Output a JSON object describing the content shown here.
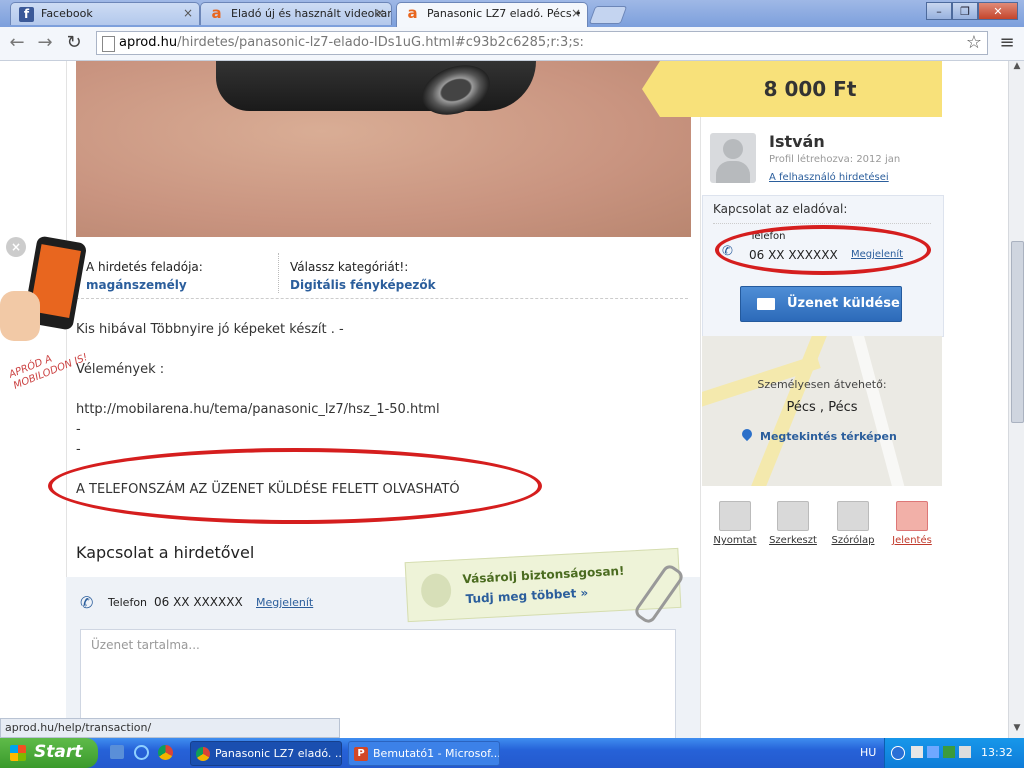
{
  "browser": {
    "tabs": [
      {
        "title": "Facebook",
        "close": "×"
      },
      {
        "title": "Eladó új és használt videokar",
        "close": "×"
      },
      {
        "title": "Panasonic LZ7 eladó. Pécs •",
        "close": "×"
      }
    ],
    "url_domain": "aprod.hu",
    "url_path": "/hirdetes/panasonic-lz7-elado-IDs1uG.html#c93b2c6285;r:3;s:",
    "status_url": "aprod.hu/help/transaction/",
    "window_buttons": [
      "–",
      "❐",
      "✕"
    ],
    "nav": {
      "back": "←",
      "forward": "→",
      "reload": "↻",
      "star": "☆",
      "menu": "≡"
    }
  },
  "listing": {
    "poster_label": "A hirdetés feladója:",
    "poster_value": "magánszemély",
    "category_label": "Válassz kategóriát!:",
    "category_value": "Digitális fényképezők",
    "description_lines": [
      "Kis hibával Többnyire jó képeket készít . -",
      "Vélemények :",
      "http://mobilarena.hu/tema/panasonic_lz7/hsz_1-50.html",
      "-",
      "-",
      "A TELEFONSZÁM AZ ÜZENET KÜLDÉSE FELETT OLVASHATÓ"
    ],
    "contact_heading": "Kapcsolat a hirdetővel",
    "contact_phone_label": "Telefon",
    "contact_phone_value": "06 XX XXXXXX",
    "contact_phone_link": "Megjelenít",
    "message_placeholder": "Üzenet tartalma...",
    "safe_title": "Vásárolj biztonságosan!",
    "safe_link": "Tudj meg többet »",
    "mobile_promo": "APRÓD A MOBILODON IS!"
  },
  "sidebar": {
    "price": "8 000 Ft",
    "seller_name": "István",
    "profile_created": "Profil létrehozva: 2012 jan",
    "user_ads_link": "A felhasználó hirdetései",
    "contact_title": "Kapcsolat az eladóval:",
    "phone_label": "Telefon",
    "phone_value": "06 XX XXXXXX",
    "phone_link": "Megjelenít",
    "message_button": "Üzenet küldése",
    "pickup_label": "Személyesen átvehető:",
    "location": "Pécs , Pécs",
    "map_link": "Megtekintés térképen",
    "tools": [
      "Nyomtat",
      "Szerkeszt",
      "Szórólap",
      "Jelentés"
    ]
  },
  "taskbar": {
    "start": "Start",
    "tasks": [
      "Panasonic LZ7 eladó. ...",
      "Bemutató1 - Microsof..."
    ],
    "lang": "HU",
    "clock": "13:32"
  },
  "colors": {
    "accent": "#2b5e9c",
    "highlight": "#d51e1e",
    "price_bg": "#f8e17a",
    "report": "#c0392b"
  }
}
